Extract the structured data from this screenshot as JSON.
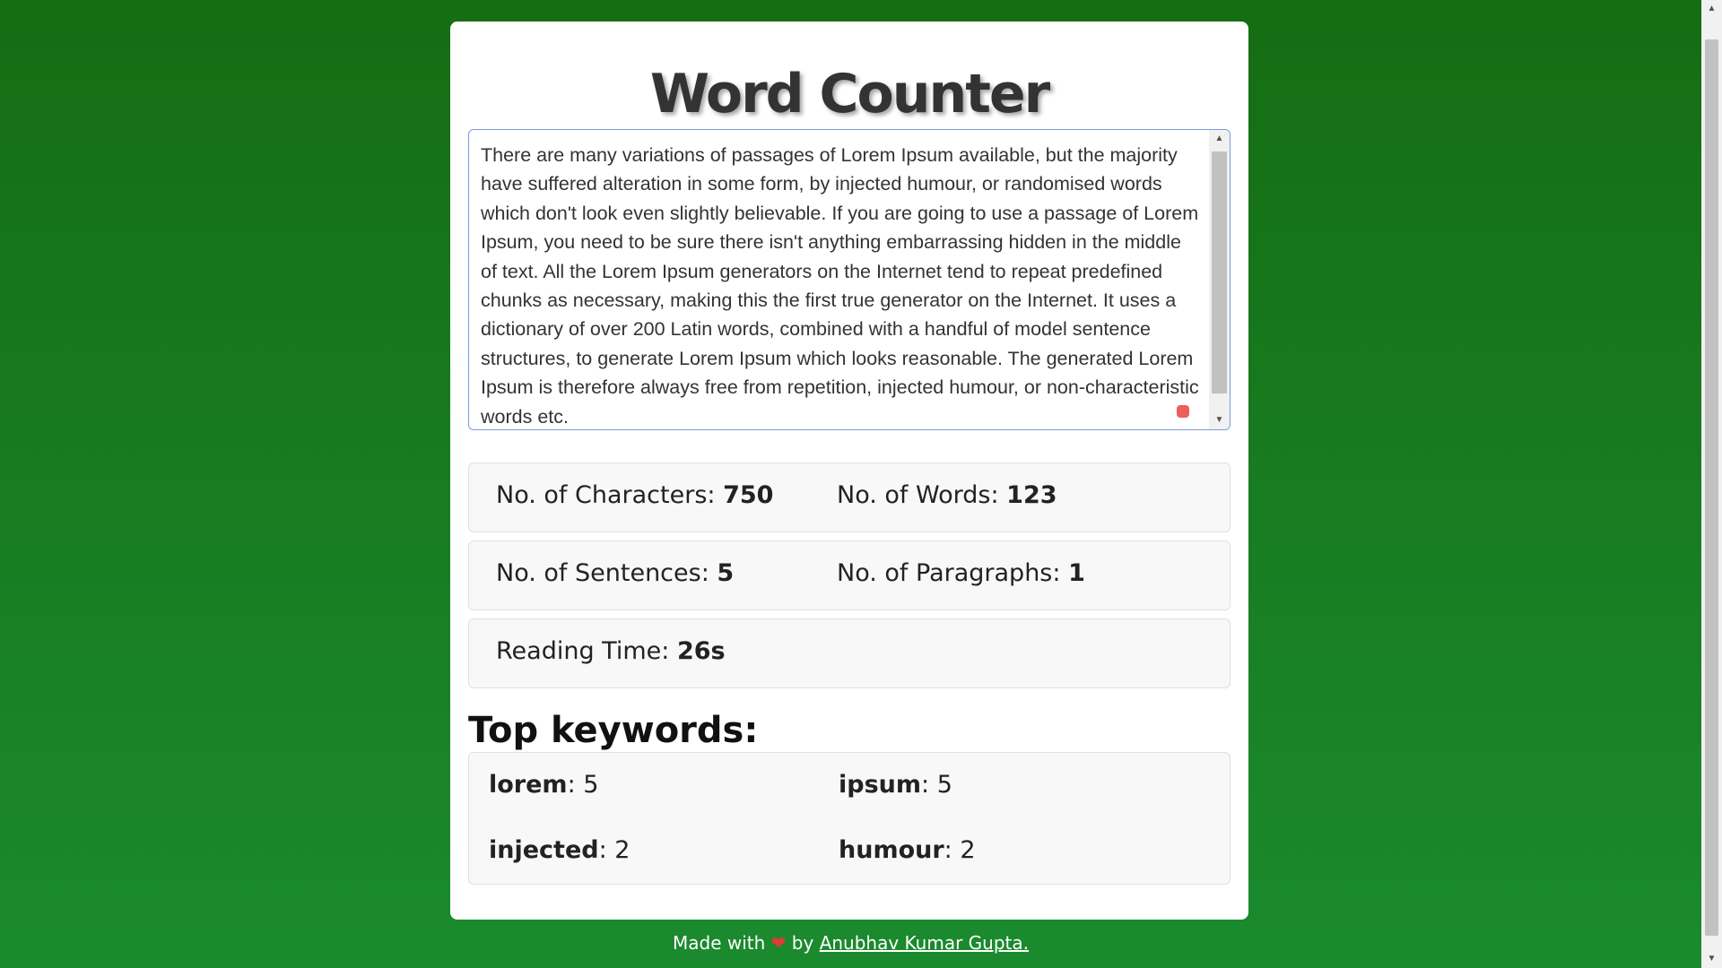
{
  "app": {
    "title": "Word Counter"
  },
  "editor": {
    "text": "There are many variations of passages of Lorem Ipsum available, but the majority have suffered alteration in some form, by injected humour, or randomised words which don't look even slightly believable. If you are going to use a passage of Lorem Ipsum, you need to be sure there isn't anything embarrassing hidden in the middle of text. All the Lorem Ipsum generators on the Internet tend to repeat predefined chunks as necessary, making this the first true generator on the Internet. It uses a dictionary of over 200 Latin words, combined with a handful of model sentence structures, to generate Lorem Ipsum which looks reasonable. The generated Lorem Ipsum is therefore always free from repetition, injected humour, or non-characteristic words etc."
  },
  "stats": {
    "characters": {
      "label": "No. of Characters:",
      "value": "750"
    },
    "words": {
      "label": "No. of Words:",
      "value": "123"
    },
    "sentences": {
      "label": "No. of Sentences:",
      "value": "5"
    },
    "paragraphs": {
      "label": "No. of Paragraphs:",
      "value": "1"
    },
    "reading_time": {
      "label": "Reading Time:",
      "value": "26s"
    }
  },
  "keywords": {
    "heading": "Top keywords:",
    "items": [
      {
        "word": "lorem",
        "count": ": 5"
      },
      {
        "word": "ipsum",
        "count": ": 5"
      },
      {
        "word": "injected",
        "count": ": 2"
      },
      {
        "word": "humour",
        "count": ": 2"
      }
    ]
  },
  "footer": {
    "made_with": "Made with",
    "heart": "❤",
    "by": "by",
    "author": "Anubhav Kumar Gupta."
  },
  "colors": {
    "background_top": "#156d12",
    "background_bottom": "#1b8a2e",
    "card": "#ffffff",
    "heart": "#e53935"
  }
}
